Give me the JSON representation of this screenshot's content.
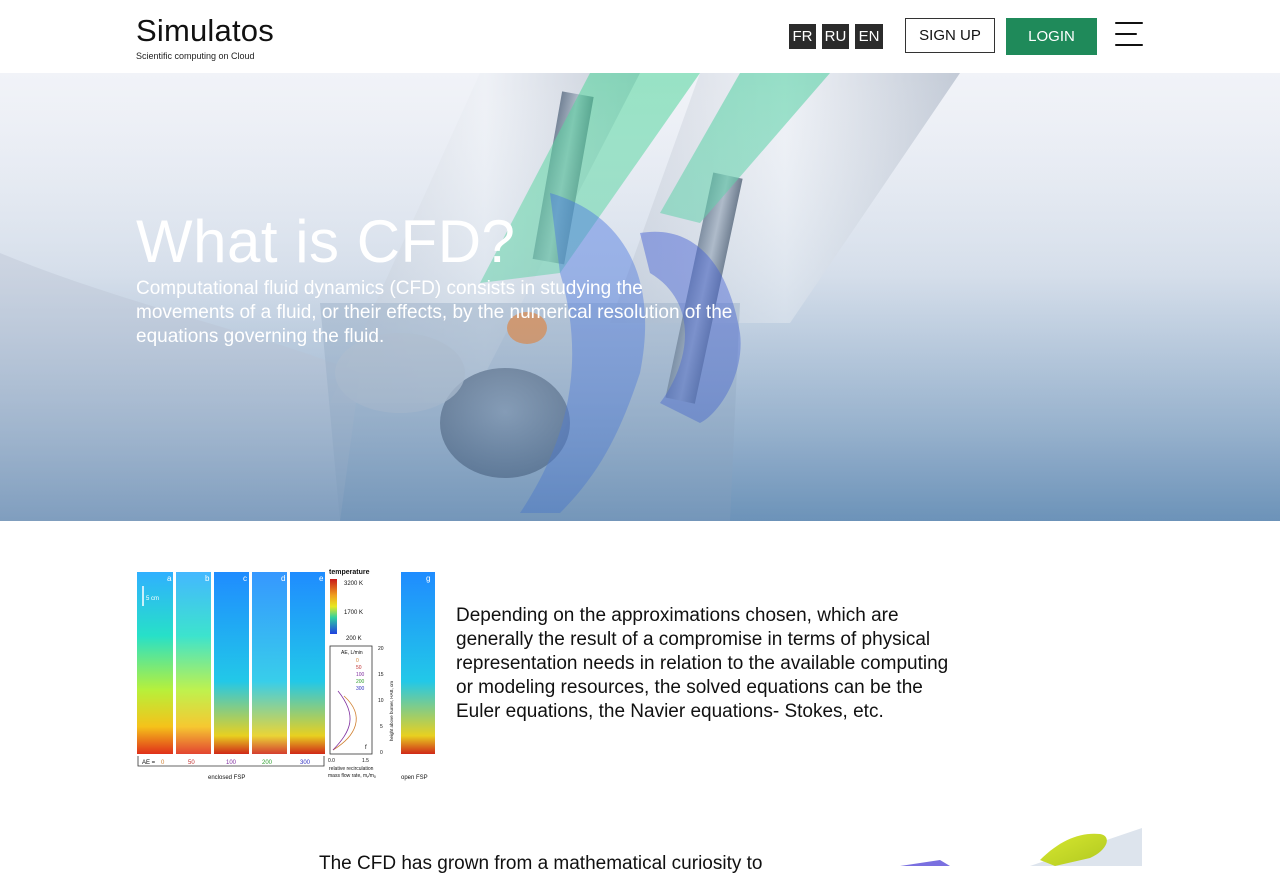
{
  "brand": {
    "name": "Simulatos",
    "tagline": "Scientific computing on Cloud"
  },
  "languages": [
    "FR",
    "RU",
    "EN"
  ],
  "nav": {
    "signup": "SIGN UP",
    "login": "LOGIN"
  },
  "colors": {
    "accent": "#1f8a5a",
    "lang_bg": "#2b2b2b"
  },
  "hero": {
    "title": "What is CFD?",
    "text": "Computational fluid dynamics (CFD) consists in studying the movements of a fluid, or their effects, by the numerical resolution of the equations governing the fluid."
  },
  "section1": {
    "text": "Depending on the approximations chosen, which are generally the result of a compromise in terms of physical representation needs in relation to the available computing or modeling resources, the solved equations can be the Euler equations, the Navier equations- Stokes, etc.",
    "figure": {
      "panel_letters": [
        "a",
        "b",
        "c",
        "d",
        "e",
        "f",
        "g"
      ],
      "scale": "5 cm",
      "colorbar_title": "temperature",
      "colorbar_ticks": [
        "3200 K",
        "1700 K",
        "200 K"
      ],
      "legend_title": "AE, L/min",
      "legend_entries": [
        "0",
        "50",
        "100",
        "200",
        "300"
      ],
      "ae_prefix": "AE =",
      "ae_values": [
        "0",
        "50",
        "100",
        "200",
        "300"
      ],
      "bottom_left_label": "enclosed FSP",
      "bottom_right_label": "open FSP",
      "y_axis_label": "height above burner, HAB, cm",
      "y_ticks": [
        "20",
        "15",
        "10",
        "5",
        "0"
      ],
      "x_ticks": [
        "0.0",
        "1.5"
      ],
      "x_axis_label_1": "relative recirculation",
      "x_axis_label_2": "mass flow rate, m",
      "x_axis_label_sub": "r",
      "x_axis_label_mid": "/m",
      "x_axis_label_sub2": "0"
    }
  },
  "section2": {
    "text": "The CFD has grown from a mathematical curiosity to"
  }
}
